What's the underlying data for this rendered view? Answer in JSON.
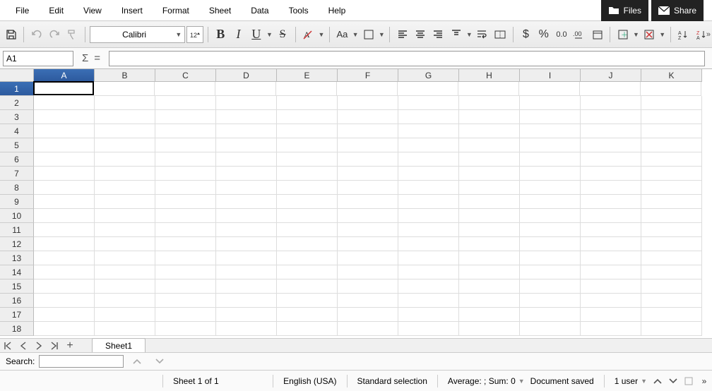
{
  "menu": {
    "items": [
      "File",
      "Edit",
      "View",
      "Insert",
      "Format",
      "Sheet",
      "Data",
      "Tools",
      "Help"
    ]
  },
  "top_buttons": {
    "files": "Files",
    "share": "Share"
  },
  "toolbar": {
    "font_name": "Calibri",
    "font_size_tip": "12",
    "icons": {
      "save": "save-icon",
      "undo": "undo-icon",
      "redo": "redo-icon",
      "clone": "clone-format-icon",
      "bold": "B",
      "italic": "I",
      "underline": "U",
      "strike": "S",
      "clearfmt": "clear-format-icon",
      "case": "Aa",
      "square": "square-icon",
      "alignL": "align-left-icon",
      "alignC": "align-center-icon",
      "alignR": "align-right-icon",
      "valign": "valign-top-icon",
      "wrap": "wrap-icon",
      "merge": "merge-icon",
      "currency": "$",
      "percent": "%",
      "dec_add": "0.0",
      "dec_rem": ".00",
      "date": "date-icon",
      "insert": "insert-icon",
      "delete": "delete-icon",
      "sort": "sort-icon",
      "autofilter": "filter-icon"
    }
  },
  "formula_bar": {
    "cell_ref": "A1",
    "sigma": "Σ",
    "eq": "=",
    "value": ""
  },
  "grid": {
    "columns": [
      "A",
      "B",
      "C",
      "D",
      "E",
      "F",
      "G",
      "H",
      "I",
      "J",
      "K"
    ],
    "rows": [
      1,
      2,
      3,
      4,
      5,
      6,
      7,
      8,
      9,
      10,
      11,
      12,
      13,
      14,
      15,
      16,
      17,
      18
    ],
    "selected_col": "A",
    "selected_row": 1,
    "active_cell": "A1"
  },
  "sheet_tabs": {
    "current": "Sheet1"
  },
  "search": {
    "label": "Search:",
    "placeholder": ""
  },
  "status": {
    "sheet_pos": "Sheet 1 of 1",
    "language": "English (USA)",
    "selection_mode": "Standard selection",
    "stats": "Average: ; Sum: 0",
    "save_state": "Document saved",
    "users": "1 user"
  }
}
